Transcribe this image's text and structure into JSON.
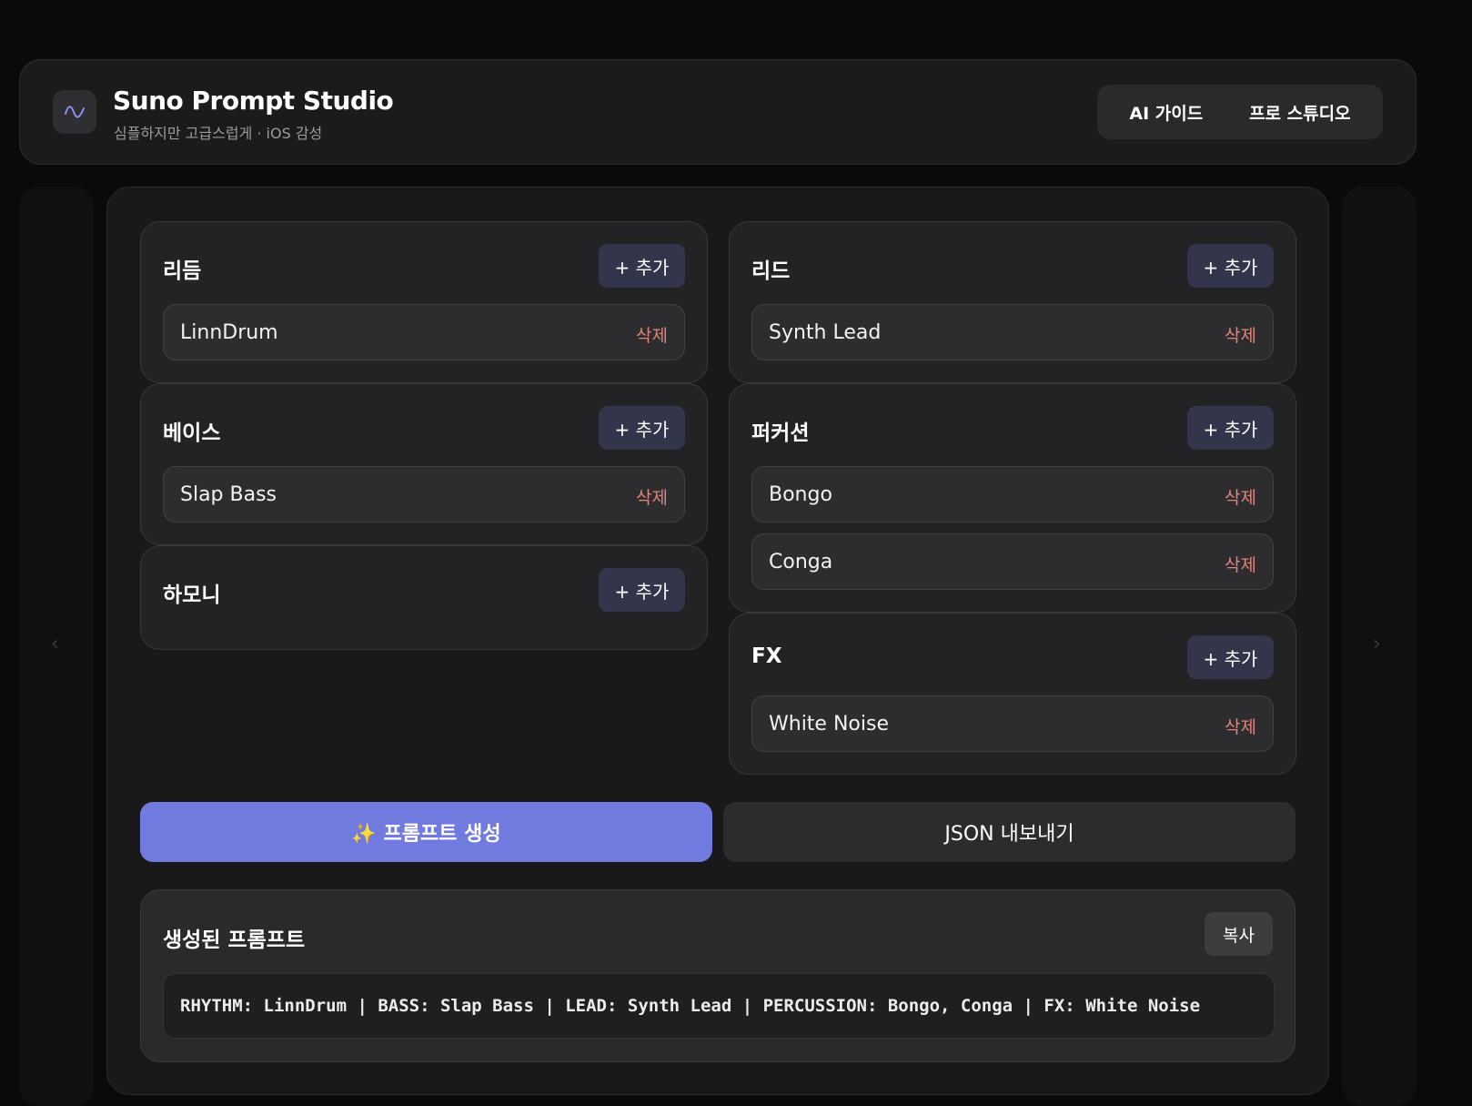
{
  "header": {
    "title": "Suno Prompt Studio",
    "subtitle": "심플하지만 고급스럽게 · iOS 감성",
    "logo_icon": "waveform-icon",
    "nav": [
      "AI 가이드",
      "프로 스튜디오"
    ]
  },
  "carousel": {
    "prev_arrow": "‹",
    "next_arrow": "›"
  },
  "sections": {
    "rhythm": {
      "title": "리듬",
      "add_label": "+ 추가",
      "items": [
        {
          "label": "LinnDrum",
          "delete_label": "삭제"
        }
      ]
    },
    "bass": {
      "title": "베이스",
      "add_label": "+ 추가",
      "items": [
        {
          "label": "Slap Bass",
          "delete_label": "삭제"
        }
      ]
    },
    "harmony": {
      "title": "하모니",
      "add_label": "+ 추가",
      "items": []
    },
    "lead": {
      "title": "리드",
      "add_label": "+ 추가",
      "items": [
        {
          "label": "Synth Lead",
          "delete_label": "삭제"
        }
      ]
    },
    "percussion": {
      "title": "퍼커션",
      "add_label": "+ 추가",
      "items": [
        {
          "label": "Bongo",
          "delete_label": "삭제"
        },
        {
          "label": "Conga",
          "delete_label": "삭제"
        }
      ]
    },
    "fx": {
      "title": "FX",
      "add_label": "+ 추가",
      "items": [
        {
          "label": "White Noise",
          "delete_label": "삭제"
        }
      ]
    }
  },
  "actions": {
    "generate_label": "✨ 프롬프트 생성",
    "export_label": "JSON 내보내기"
  },
  "output": {
    "title": "생성된 프롬프트",
    "copy_label": "복사",
    "text": "RHYTHM: LinnDrum | BASS: Slap Bass | LEAD: Synth Lead | PERCUSSION: Bongo, Conga | FX: White Noise"
  },
  "colors": {
    "accent": "#717adf",
    "delete": "#e0837b",
    "add_button": "#33354a",
    "background": "#0a0a0a"
  }
}
